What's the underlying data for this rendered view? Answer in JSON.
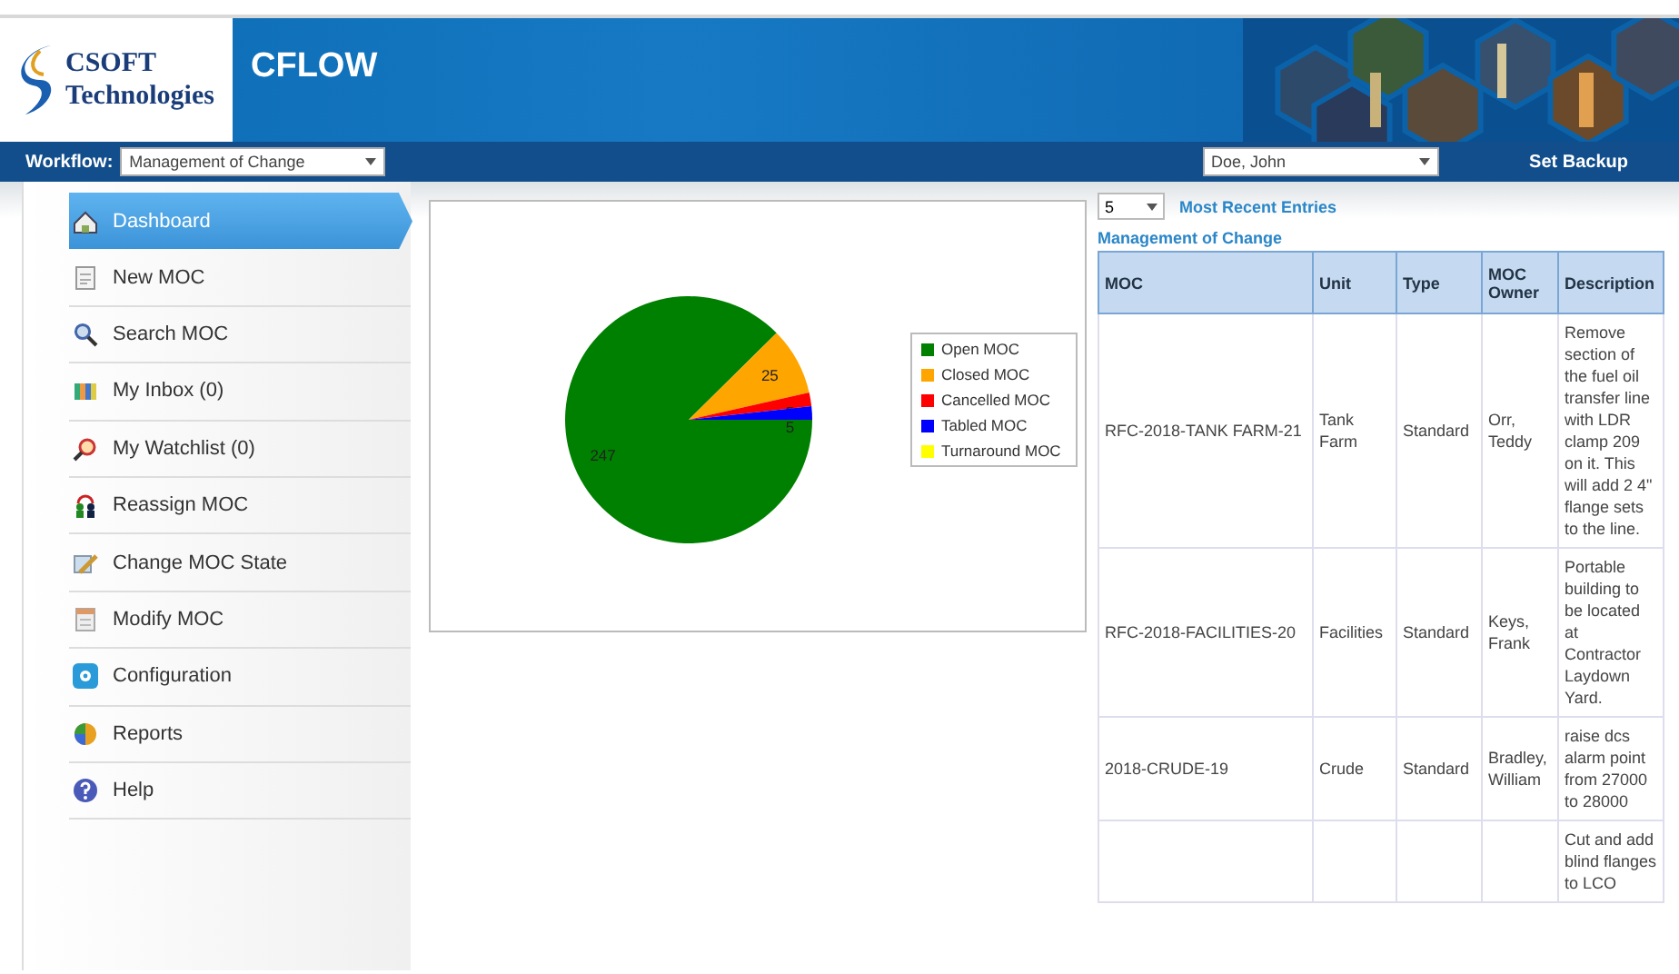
{
  "header": {
    "logo_line1": "CSOFT",
    "logo_line2": "Technologies",
    "app_title": "CFLOW"
  },
  "toolbar": {
    "workflow_label": "Workflow:",
    "workflow_value": "Management of Change",
    "user_value": "Doe, John",
    "set_backup": "Set Backup"
  },
  "sidebar": {
    "items": [
      {
        "label": "Dashboard",
        "selected": true
      },
      {
        "label": "New MOC",
        "selected": false
      },
      {
        "label": "Search MOC",
        "selected": false
      },
      {
        "label": "My Inbox (0)",
        "selected": false
      },
      {
        "label": "My Watchlist (0)",
        "selected": false
      },
      {
        "label": "Reassign MOC",
        "selected": false
      },
      {
        "label": "Change MOC State",
        "selected": false
      },
      {
        "label": "Modify MOC",
        "selected": false
      },
      {
        "label": "Configuration",
        "selected": false
      },
      {
        "label": "Reports",
        "selected": false
      },
      {
        "label": "Help",
        "selected": false
      }
    ]
  },
  "chart_panel": {
    "chart_data": {
      "type": "pie",
      "categories": [
        "Open MOC",
        "Closed MOC",
        "Cancelled MOC",
        "Tabled MOC",
        "Turnaround MOC"
      ],
      "values": [
        247,
        25,
        5,
        5,
        0
      ],
      "legend": "right",
      "colors": [
        "#008000",
        "#ffa500",
        "#ff0000",
        "#0000ff",
        "#ffff00"
      ],
      "data_labels": true
    }
  },
  "recent": {
    "count_value": "5",
    "title": "Most Recent Entries",
    "subtitle": "Management of Change",
    "table": {
      "columns": [
        "MOC",
        "Unit",
        "Type",
        "MOC Owner",
        "Description"
      ],
      "rows": [
        [
          "RFC-2018-TANK FARM-21",
          "Tank Farm",
          "Standard",
          "Orr, Teddy",
          "Remove section of the fuel oil transfer line with LDR clamp 209 on it. This will add 2 4\" flange sets to the line."
        ],
        [
          "RFC-2018-FACILITIES-20",
          "Facilities",
          "Standard",
          "Keys, Frank",
          "Portable building to be located at Contractor Laydown Yard."
        ],
        [
          "2018-CRUDE-19",
          "Crude",
          "Standard",
          "Bradley, William",
          "raise dcs alarm point from 27000 to 28000"
        ],
        [
          "",
          "",
          "",
          "",
          "Cut and add blind flanges to LCO"
        ]
      ]
    }
  }
}
